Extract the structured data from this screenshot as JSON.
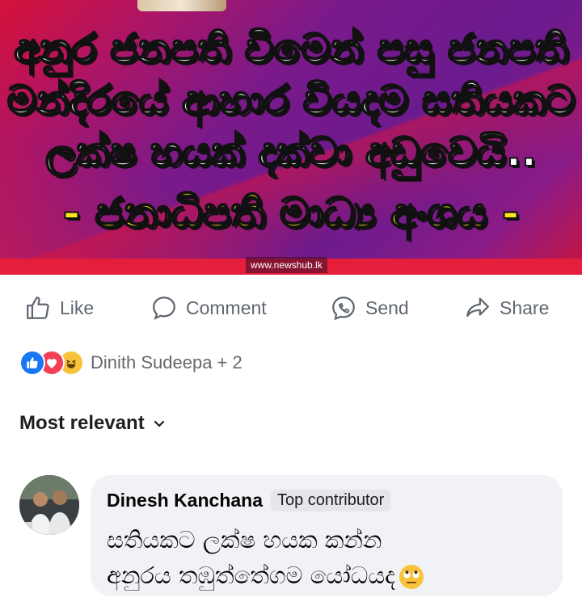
{
  "post_image": {
    "headline_lines": [
      "අනුර ජනපති වීමෙන් පසු ජනපති",
      "මන්දිරයේ ආහාර වියදම සතියකට",
      "ලක්ෂ හයක් දක්වා අඩුවෙයි.."
    ],
    "source_line": "- ජනාධිපති මාධ්‍ය අංශය -",
    "watermark": "www.newshub.lk",
    "colors": {
      "background": "#6a1b8f",
      "accent_red": "#e51f3b",
      "headline": "#ffffff",
      "source": "#ffe51f"
    }
  },
  "actions": {
    "like": {
      "label": "Like",
      "icon": "thumbs-up-icon"
    },
    "comment": {
      "label": "Comment",
      "icon": "speech-bubble-icon"
    },
    "send": {
      "label": "Send",
      "icon": "messenger-icon"
    },
    "share": {
      "label": "Share",
      "icon": "share-arrow-icon"
    }
  },
  "reactions": {
    "icons": [
      "like-reaction-icon",
      "love-reaction-icon",
      "haha-reaction-icon"
    ],
    "summary": "Dinith Sudeepa + 2"
  },
  "comments_sort": {
    "label": "Most relevant",
    "icon": "chevron-down-icon"
  },
  "comment": {
    "author": "Dinesh Kanchana",
    "badge": "Top contributor",
    "text_lines": [
      "සතියකට ලක්ෂ හයක කන්න",
      "අනුරය තඹුත්තේගම යෝධයද"
    ],
    "emoji": "face-with-rolling-eyes"
  }
}
